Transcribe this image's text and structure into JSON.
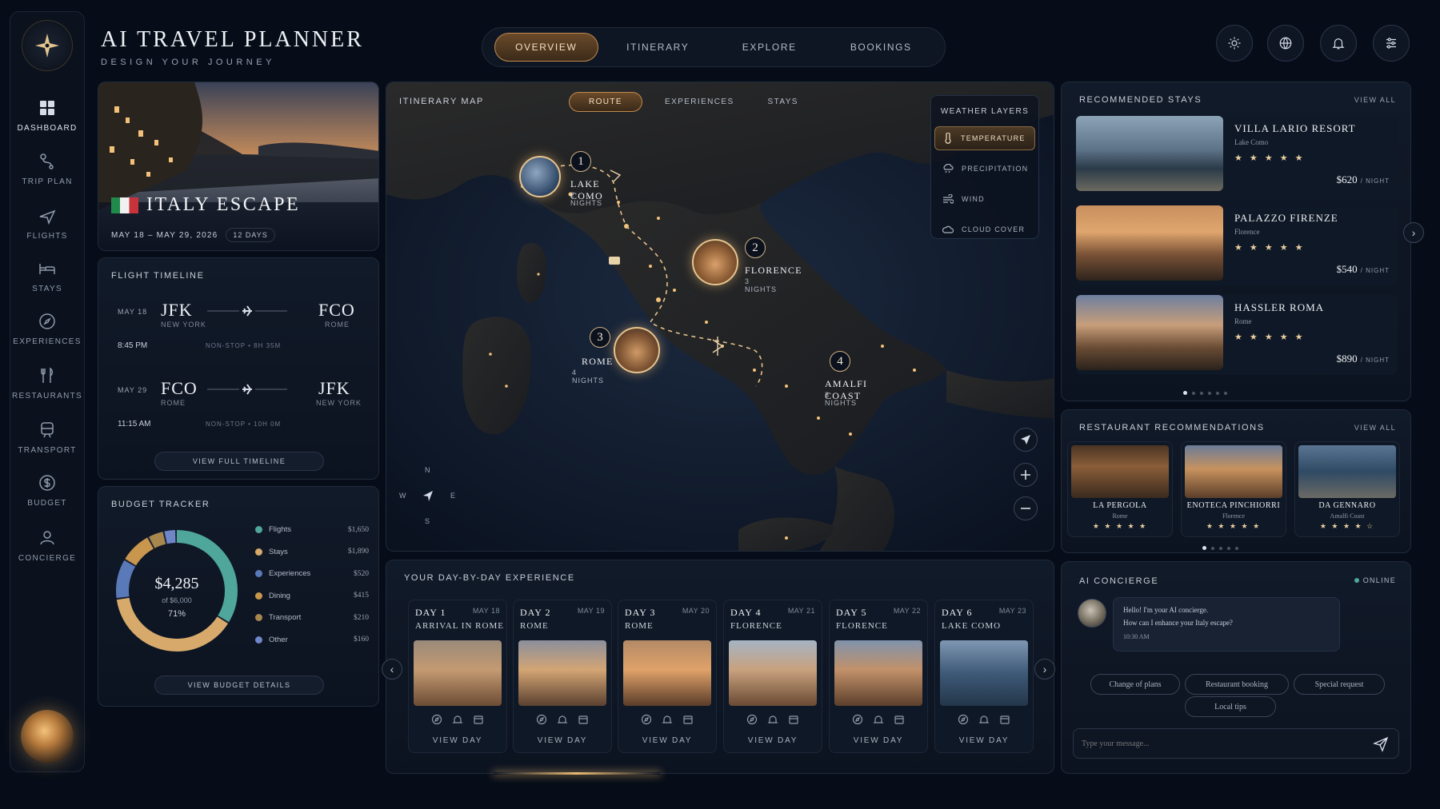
{
  "brand": {
    "title": "AI TRAVEL PLANNER",
    "subtitle": "DESIGN YOUR JOURNEY"
  },
  "topnav": {
    "tabs": [
      "OVERVIEW",
      "ITINERARY",
      "EXPLORE",
      "BOOKINGS"
    ],
    "active": "OVERVIEW"
  },
  "topbar_icons": [
    "sun-icon",
    "globe-icon",
    "bell-icon",
    "sliders-icon"
  ],
  "sidebar": {
    "items": [
      {
        "label": "DASHBOARD",
        "icon": "grid-icon"
      },
      {
        "label": "TRIP PLAN",
        "icon": "route-icon"
      },
      {
        "label": "FLIGHTS",
        "icon": "plane-icon"
      },
      {
        "label": "STAYS",
        "icon": "bed-icon"
      },
      {
        "label": "EXPERIENCES",
        "icon": "compass-icon"
      },
      {
        "label": "RESTAURANTS",
        "icon": "fork-knife-icon"
      },
      {
        "label": "TRANSPORT",
        "icon": "train-icon"
      },
      {
        "label": "BUDGET",
        "icon": "dollar-icon"
      },
      {
        "label": "CONCIERGE",
        "icon": "concierge-icon"
      }
    ]
  },
  "trip": {
    "name": "ITALY ESCAPE",
    "dates": "MAY 18 – MAY 29, 2026",
    "duration": "12 DAYS"
  },
  "flights": {
    "title": "FLIGHT TIMELINE",
    "legs": [
      {
        "date": "MAY 18",
        "from": "JFK",
        "from_city": "NEW YORK",
        "to": "FCO",
        "to_city": "ROME",
        "time": "8:45 PM",
        "info": "NON-STOP • 8H 35M"
      },
      {
        "date": "MAY 29",
        "from": "FCO",
        "from_city": "ROME",
        "to": "JFK",
        "to_city": "NEW YORK",
        "time": "11:15 AM",
        "info": "NON-STOP • 10H 0M"
      }
    ],
    "cta": "VIEW FULL TIMELINE"
  },
  "budget": {
    "title": "BUDGET TRACKER",
    "total": "$4,285",
    "of": "of $6,000",
    "percent": "71%",
    "spent_fraction": 0.71,
    "items": [
      {
        "label": "Flights",
        "amount": "$1,650",
        "color": "#4fa79b"
      },
      {
        "label": "Stays",
        "amount": "$1,890",
        "color": "#d7aa6b"
      },
      {
        "label": "Experiences",
        "amount": "$520",
        "color": "#5a79b8"
      },
      {
        "label": "Dining",
        "amount": "$415",
        "color": "#c9964e"
      },
      {
        "label": "Transport",
        "amount": "$210",
        "color": "#a8874f"
      },
      {
        "label": "Other",
        "amount": "$160",
        "color": "#6f86c9"
      }
    ],
    "cta": "VIEW BUDGET DETAILS"
  },
  "map": {
    "title": "ITINERARY MAP",
    "tabs": [
      "ROUTE",
      "EXPERIENCES",
      "STAYS"
    ],
    "active_tab": "ROUTE",
    "stops": [
      {
        "num": "1",
        "name": "LAKE COMO",
        "nights": "2 NIGHTS"
      },
      {
        "num": "2",
        "name": "FLORENCE",
        "nights": "3 NIGHTS"
      },
      {
        "num": "3",
        "name": "ROME",
        "nights": "4 NIGHTS"
      },
      {
        "num": "4",
        "name": "AMALFI COAST",
        "nights": "3 NIGHTS"
      }
    ],
    "weather": {
      "title": "WEATHER LAYERS",
      "layers": [
        {
          "label": "TEMPERATURE",
          "icon": "thermometer-icon"
        },
        {
          "label": "PRECIPITATION",
          "icon": "rain-cloud-icon"
        },
        {
          "label": "WIND",
          "icon": "wind-icon"
        },
        {
          "label": "CLOUD COVER",
          "icon": "cloud-icon"
        }
      ],
      "active": "TEMPERATURE"
    },
    "compass": {
      "n": "N",
      "s": "S",
      "w": "W",
      "e": "E"
    },
    "controls": [
      "locate-icon",
      "plus-icon",
      "minus-icon"
    ]
  },
  "stays": {
    "title": "RECOMMENDED STAYS",
    "view_all": "VIEW ALL",
    "items": [
      {
        "name": "VILLA LARIO RESORT",
        "city": "Lake Como",
        "stars": "★ ★ ★ ★ ★",
        "price": "$620",
        "unit": "/ NIGHT"
      },
      {
        "name": "PALAZZO FIRENZE",
        "city": "Florence",
        "stars": "★ ★ ★ ★ ★",
        "price": "$540",
        "unit": "/ NIGHT"
      },
      {
        "name": "HASSLER ROMA",
        "city": "Rome",
        "stars": "★ ★ ★ ★ ★",
        "price": "$890",
        "unit": "/ NIGHT"
      }
    ]
  },
  "restaurants": {
    "title": "RESTAURANT RECOMMENDATIONS",
    "view_all": "VIEW ALL",
    "items": [
      {
        "name": "LA PERGOLA",
        "city": "Rome",
        "stars": "★ ★ ★ ★ ★"
      },
      {
        "name": "ENOTECA PINCHIORRI",
        "city": "Florence",
        "stars": "★ ★ ★ ★ ★"
      },
      {
        "name": "DA GENNARO",
        "city": "Amalfi Coast",
        "stars": "★ ★ ★ ★ ☆"
      }
    ]
  },
  "days": {
    "title": "YOUR DAY-BY-DAY EXPERIENCE",
    "cta": "VIEW DAY",
    "items": [
      {
        "day": "DAY 1",
        "date": "MAY 18",
        "title": "ARRIVAL IN ROME"
      },
      {
        "day": "DAY 2",
        "date": "MAY 19",
        "title": "ROME"
      },
      {
        "day": "DAY 3",
        "date": "MAY 20",
        "title": "ROME"
      },
      {
        "day": "DAY 4",
        "date": "MAY 21",
        "title": "FLORENCE"
      },
      {
        "day": "DAY 5",
        "date": "MAY 22",
        "title": "FLORENCE"
      },
      {
        "day": "DAY 6",
        "date": "MAY 23",
        "title": "LAKE COMO"
      }
    ]
  },
  "concierge": {
    "title": "AI CONCIERGE",
    "status": "ONLINE",
    "message_line1": "Hello! I'm your AI concierge.",
    "message_line2": "How can I enhance your Italy escape?",
    "message_time": "10:30 AM",
    "chips": [
      "Change of plans",
      "Restaurant booking",
      "Special request",
      "Local tips"
    ],
    "placeholder": "Type your message..."
  }
}
